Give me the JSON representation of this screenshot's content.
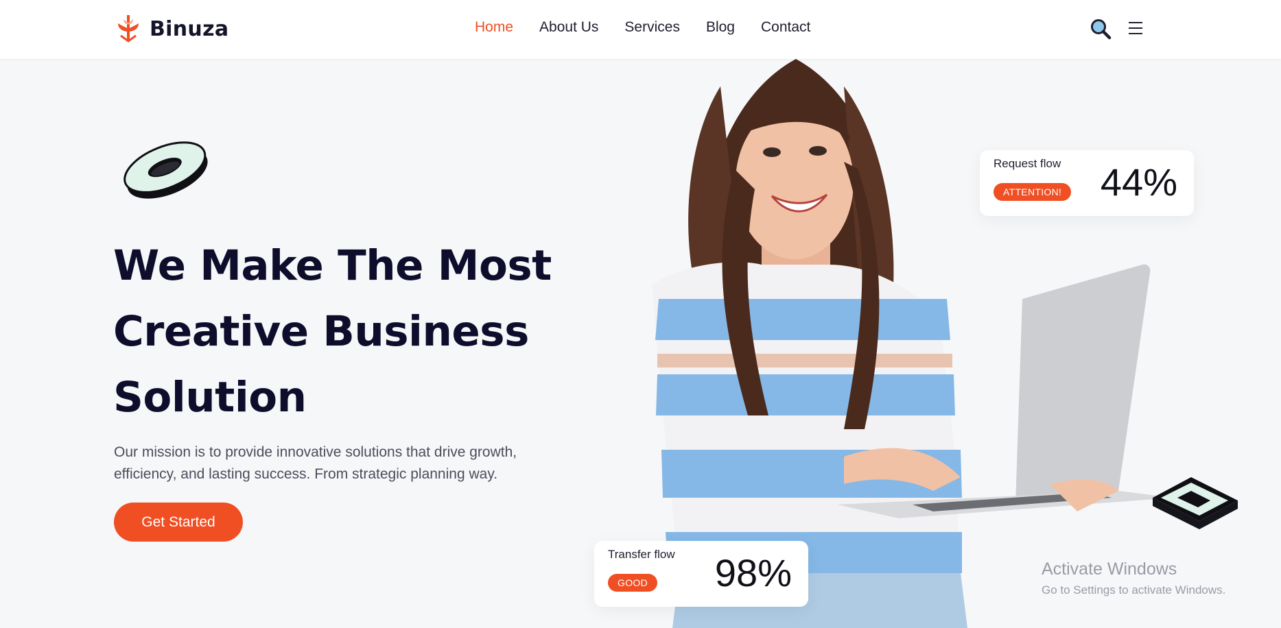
{
  "header": {
    "brand": "Binuza",
    "nav": [
      {
        "label": "Home",
        "active": true
      },
      {
        "label": "About Us",
        "active": false
      },
      {
        "label": "Services",
        "active": false
      },
      {
        "label": "Blog",
        "active": false
      },
      {
        "label": "Contact",
        "active": false
      }
    ],
    "icons": {
      "logo": "leaf-anchor-icon",
      "search": "search-icon",
      "menu": "menu-icon"
    }
  },
  "hero": {
    "headline_lines": [
      "We Make The Most",
      "Creative Business",
      "Solution"
    ],
    "description": "Our mission is to provide innovative solutions that drive growth, efficiency, and lasting success. From strategic planning way.",
    "cta_label": "Get Started"
  },
  "stats": {
    "request": {
      "label": "Request flow",
      "badge": "ATTENTION!",
      "value": "44%"
    },
    "transfer": {
      "label": "Transfer flow",
      "badge": "GOOD",
      "value": "98%"
    }
  },
  "watermark": {
    "title": "Activate Windows",
    "subtitle": "Go to Settings to activate Windows."
  },
  "colors": {
    "accent": "#f04e23",
    "heading": "#0e0e2c",
    "background": "#f6f7f9"
  }
}
